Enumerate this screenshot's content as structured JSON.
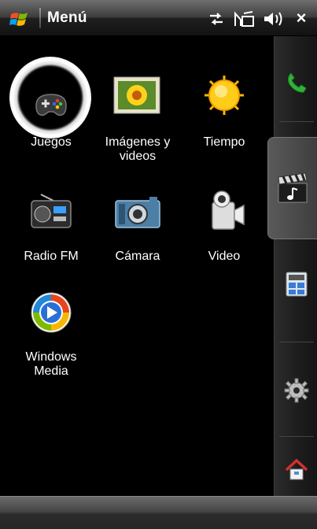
{
  "topbar": {
    "title": "Menú",
    "close_label": "×"
  },
  "apps": [
    {
      "label": "Juegos",
      "icon": "games-icon",
      "selected": true
    },
    {
      "label": "Imágenes y\nvideos",
      "icon": "pictures-icon",
      "selected": false
    },
    {
      "label": "Tiempo",
      "icon": "weather-sun-icon",
      "selected": false
    },
    {
      "label": "Radio FM",
      "icon": "radio-icon",
      "selected": false
    },
    {
      "label": "Cámara",
      "icon": "camera-icon",
      "selected": false
    },
    {
      "label": "Video",
      "icon": "video-camera-icon",
      "selected": false
    },
    {
      "label": "Windows\nMedia",
      "icon": "windows-media-icon",
      "selected": false
    }
  ],
  "sidebar": {
    "items": [
      {
        "icon": "phone-icon",
        "selected": false
      },
      {
        "icon": "media-clapper-icon",
        "selected": true
      },
      {
        "icon": "calculator-icon",
        "selected": false
      },
      {
        "icon": "settings-gear-icon",
        "selected": false
      },
      {
        "icon": "home-icon",
        "selected": false
      }
    ]
  },
  "colors": {
    "accent_green": "#2fb33a",
    "sun_yellow": "#ffcc1a",
    "background": "#000000"
  }
}
